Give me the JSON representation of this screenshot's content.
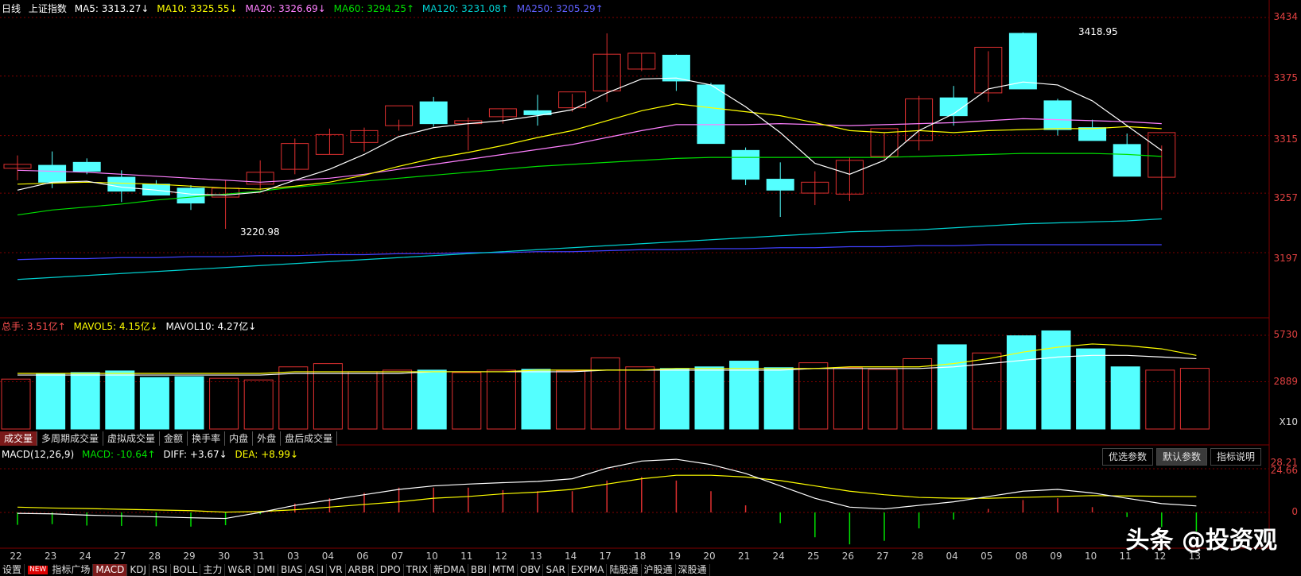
{
  "candles": {
    "period_label": "日线",
    "index_name": "上证指数",
    "ma5": "MA5: 3313.27↓",
    "ma10": "MA10: 3325.55↓",
    "ma20": "MA20: 3326.69↓",
    "ma60": "MA60: 3294.25↑",
    "ma120": "MA120: 3231.08↑",
    "ma250": "MA250: 3205.29↑",
    "high_label": "3418.95",
    "low_label": "3220.98",
    "y_ticks": [
      "3434",
      "3375",
      "3315",
      "3257",
      "3197"
    ]
  },
  "volume": {
    "total": "总手: 3.51亿↑",
    "mavol5": "MAVOL5: 4.15亿↓",
    "mavol10": "MAVOL10: 4.27亿↓",
    "y_ticks": [
      "5730",
      "2889"
    ],
    "unit": "X10"
  },
  "vol_tabs": [
    "成交量",
    "多周期成交量",
    "虚拟成交量",
    "金额",
    "换手率",
    "内盘",
    "外盘",
    "盘后成交量"
  ],
  "macd": {
    "params": "MACD(12,26,9)",
    "macd": "MACD: -10.64↑",
    "diff": "DIFF: +3.67↓",
    "dea": "DEA: +8.99↓",
    "y_ticks": [
      "28.21",
      "24.66",
      "0"
    ]
  },
  "macd_buttons": [
    "优选参数",
    "默认参数",
    "指标说明"
  ],
  "x_labels": [
    "22",
    "23",
    "24",
    "27",
    "28",
    "29",
    "30",
    "31",
    "03",
    "04",
    "06",
    "07",
    "10",
    "11",
    "12",
    "13",
    "14",
    "17",
    "18",
    "19",
    "20",
    "21",
    "24",
    "25",
    "26",
    "27",
    "28",
    "04",
    "05",
    "08",
    "09",
    "10",
    "11",
    "12",
    "13"
  ],
  "bottom_tabs": [
    "设置",
    "指标广场",
    "MACD",
    "KDJ",
    "RSI",
    "BOLL",
    "主力",
    "W&R",
    "DMI",
    "BIAS",
    "ASI",
    "VR",
    "ARBR",
    "DPO",
    "TRIX",
    "新DMA",
    "BBI",
    "MTM",
    "OBV",
    "SAR",
    "EXPMA",
    "陆股通",
    "沪股通",
    "深股通"
  ],
  "new_tag": "NEW",
  "watermark": "头条 @投资观",
  "colors": {
    "up": "#e03030",
    "down": "#54ffff",
    "ma5": "#ffffff",
    "ma10": "#ffff00",
    "ma20": "#ff80ff",
    "ma60": "#00e000",
    "ma120": "#00d0d0",
    "ma250": "#4040ff",
    "grid": "#800000",
    "tick": "#e04040"
  },
  "chart_data": {
    "type": "candlestick",
    "ohlc": [
      [
        3282,
        3295,
        3270,
        3286
      ],
      [
        3285,
        3299,
        3262,
        3268
      ],
      [
        3288,
        3292,
        3276,
        3279
      ],
      [
        3273,
        3280,
        3248,
        3259
      ],
      [
        3266,
        3270,
        3256,
        3255
      ],
      [
        3262,
        3265,
        3240,
        3247
      ],
      [
        3253,
        3270,
        3221,
        3262
      ],
      [
        3266,
        3290,
        3260,
        3278
      ],
      [
        3281,
        3312,
        3276,
        3307
      ],
      [
        3296,
        3322,
        3296,
        3316
      ],
      [
        3308,
        3323,
        3299,
        3320
      ],
      [
        3325,
        3331,
        3320,
        3345
      ],
      [
        3349,
        3354,
        3324,
        3327
      ],
      [
        3327,
        3333,
        3300,
        3330
      ],
      [
        3334,
        3342,
        3327,
        3342
      ],
      [
        3340,
        3356,
        3325,
        3336
      ],
      [
        3343,
        3357,
        3339,
        3359
      ],
      [
        3360,
        3418,
        3349,
        3397
      ],
      [
        3382,
        3398,
        3380,
        3398
      ],
      [
        3396,
        3397,
        3360,
        3370
      ],
      [
        3366,
        3368,
        3340,
        3307
      ],
      [
        3300,
        3303,
        3265,
        3271
      ],
      [
        3271,
        3288,
        3233,
        3260
      ],
      [
        3257,
        3279,
        3245,
        3268
      ],
      [
        3256,
        3293,
        3249,
        3290
      ],
      [
        3294,
        3318,
        3291,
        3322
      ],
      [
        3310,
        3355,
        3300,
        3352
      ],
      [
        3353,
        3365,
        3325,
        3335
      ],
      [
        3358,
        3400,
        3349,
        3404
      ],
      [
        3418,
        3419,
        3362,
        3362
      ],
      [
        3350,
        3352,
        3315,
        3321
      ],
      [
        3323,
        3331,
        3312,
        3310
      ],
      [
        3306,
        3317,
        3276,
        3274
      ],
      [
        3273,
        3305,
        3240,
        3318
      ]
    ],
    "ma5": [
      3260,
      3268,
      3269,
      3263,
      3260,
      3256,
      3255,
      3258,
      3270,
      3281,
      3296,
      3314,
      3323,
      3327,
      3330,
      3335,
      3341,
      3358,
      3372,
      3373,
      3366,
      3344,
      3318,
      3287,
      3276,
      3290,
      3320,
      3337,
      3362,
      3369,
      3366,
      3350,
      3325,
      3300
    ],
    "ma10": [
      3266,
      3267,
      3268,
      3267,
      3266,
      3264,
      3262,
      3261,
      3264,
      3268,
      3275,
      3284,
      3292,
      3298,
      3305,
      3313,
      3320,
      3330,
      3340,
      3347,
      3343,
      3339,
      3335,
      3328,
      3320,
      3318,
      3320,
      3318,
      3320,
      3321,
      3322,
      3322,
      3324,
      3322
    ],
    "ma20": [
      3280,
      3279,
      3278,
      3276,
      3274,
      3272,
      3270,
      3268,
      3270,
      3272,
      3276,
      3281,
      3286,
      3291,
      3296,
      3301,
      3306,
      3313,
      3320,
      3326,
      3326,
      3326,
      3327,
      3326,
      3325,
      3326,
      3327,
      3328,
      3330,
      3332,
      3331,
      3330,
      3329,
      3327
    ],
    "ma60": [
      3235,
      3240,
      3243,
      3246,
      3250,
      3253,
      3256,
      3259,
      3263,
      3266,
      3269,
      3272,
      3275,
      3278,
      3281,
      3284,
      3286,
      3288,
      3290,
      3292,
      3293,
      3293,
      3293,
      3293,
      3293,
      3293,
      3294,
      3295,
      3296,
      3297,
      3297,
      3297,
      3296,
      3294
    ],
    "ma120": [
      3170,
      3172,
      3174,
      3176,
      3178,
      3180,
      3182,
      3184,
      3186,
      3188,
      3190,
      3192,
      3194,
      3196,
      3198,
      3200,
      3202,
      3204,
      3206,
      3208,
      3210,
      3212,
      3214,
      3216,
      3218,
      3219,
      3220,
      3222,
      3224,
      3226,
      3227,
      3228,
      3229,
      3231
    ],
    "ma250": [
      3190,
      3191,
      3191,
      3192,
      3192,
      3193,
      3193,
      3194,
      3194,
      3195,
      3195,
      3196,
      3196,
      3197,
      3197,
      3198,
      3198,
      3199,
      3200,
      3200,
      3201,
      3201,
      3202,
      3202,
      3203,
      3203,
      3204,
      3204,
      3205,
      3205,
      3205,
      3205,
      3205,
      3205
    ],
    "volume": [
      3.05,
      3.35,
      3.45,
      3.55,
      3.15,
      3.2,
      3.1,
      3.0,
      3.8,
      4.0,
      3.5,
      3.6,
      3.6,
      3.45,
      3.6,
      3.65,
      3.55,
      4.35,
      3.8,
      3.7,
      3.8,
      4.15,
      3.75,
      4.05,
      3.75,
      3.65,
      4.3,
      5.15,
      4.65,
      5.7,
      6.0,
      4.9,
      3.8,
      3.6,
      3.71
    ],
    "mavol5": [
      3.4,
      3.4,
      3.4,
      3.4,
      3.4,
      3.4,
      3.4,
      3.4,
      3.5,
      3.5,
      3.5,
      3.5,
      3.5,
      3.5,
      3.5,
      3.6,
      3.6,
      3.6,
      3.6,
      3.7,
      3.7,
      3.7,
      3.7,
      3.7,
      3.8,
      3.8,
      3.8,
      4.0,
      4.3,
      4.7,
      5.0,
      5.2,
      5.1,
      4.9,
      4.5
    ],
    "mavol10": [
      3.3,
      3.3,
      3.3,
      3.3,
      3.3,
      3.3,
      3.3,
      3.3,
      3.4,
      3.4,
      3.4,
      3.4,
      3.5,
      3.5,
      3.5,
      3.5,
      3.5,
      3.6,
      3.6,
      3.6,
      3.6,
      3.6,
      3.6,
      3.7,
      3.7,
      3.7,
      3.7,
      3.8,
      4.0,
      4.2,
      4.4,
      4.5,
      4.5,
      4.4,
      4.3
    ],
    "diff": [
      -0.5,
      -0.8,
      -1.5,
      -2.0,
      -2.5,
      -3,
      -3.4,
      0,
      4,
      7,
      10,
      13,
      15,
      16,
      16.8,
      17.5,
      19,
      25,
      29,
      30,
      27,
      22,
      15,
      8,
      3,
      2,
      4,
      6,
      9,
      12,
      13,
      11,
      8,
      5,
      3.67
    ],
    "dea": [
      3,
      2.5,
      2.2,
      1.8,
      1.4,
      1,
      0.2,
      0.5,
      1.5,
      3,
      4.5,
      6,
      8,
      9,
      10.5,
      11.5,
      13,
      16,
      19,
      21,
      21,
      20,
      18,
      15,
      12,
      10,
      8.5,
      8,
      8,
      8.5,
      9,
      9.5,
      9.3,
      9.1,
      8.99
    ]
  }
}
